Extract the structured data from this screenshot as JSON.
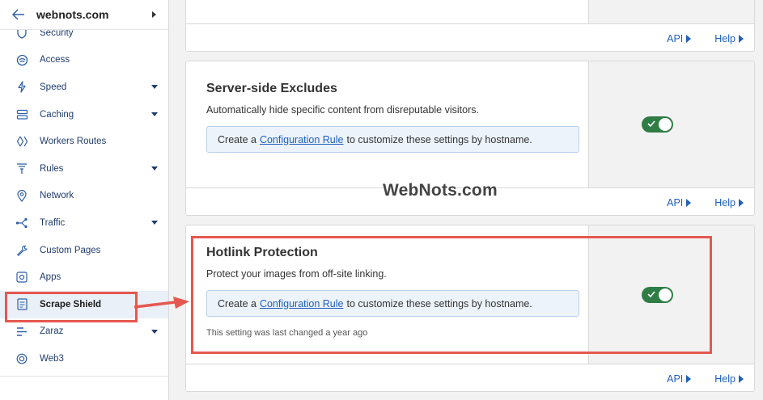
{
  "sidebar": {
    "domain": "webnots.com",
    "items": [
      {
        "label": "Security",
        "icon": "shield-icon",
        "caret": false
      },
      {
        "label": "Access",
        "icon": "access-icon",
        "caret": false
      },
      {
        "label": "Speed",
        "icon": "lightning-icon",
        "caret": true
      },
      {
        "label": "Caching",
        "icon": "caching-icon",
        "caret": true
      },
      {
        "label": "Workers Routes",
        "icon": "workers-icon",
        "caret": false
      },
      {
        "label": "Rules",
        "icon": "rules-icon",
        "caret": true
      },
      {
        "label": "Network",
        "icon": "location-pin-icon",
        "caret": false
      },
      {
        "label": "Traffic",
        "icon": "traffic-icon",
        "caret": true
      },
      {
        "label": "Custom Pages",
        "icon": "wrench-icon",
        "caret": false
      },
      {
        "label": "Apps",
        "icon": "apps-icon",
        "caret": false
      },
      {
        "label": "Scrape Shield",
        "icon": "scrape-shield-icon",
        "caret": false,
        "active": true
      },
      {
        "label": "Zaraz",
        "icon": "zaraz-icon",
        "caret": true
      },
      {
        "label": "Web3",
        "icon": "web3-icon",
        "caret": false
      }
    ]
  },
  "cards": {
    "top": {
      "api": "API",
      "help": "Help"
    },
    "server_side_excludes": {
      "title": "Server-side Excludes",
      "description": "Automatically hide specific content from disreputable visitors.",
      "info_prefix": "Create a",
      "info_link": "Configuration Rule",
      "info_suffix": "to customize these settings by hostname.",
      "enabled": true,
      "api": "API",
      "help": "Help"
    },
    "hotlink_protection": {
      "title": "Hotlink Protection",
      "description": "Protect your images from off-site linking.",
      "info_prefix": "Create a",
      "info_link": "Configuration Rule",
      "info_suffix": "to customize these settings by hostname.",
      "changed_note": "This setting was last changed a year ago",
      "enabled": true,
      "api": "API",
      "help": "Help"
    }
  },
  "watermark": "WebNots.com",
  "colors": {
    "accent": "#1f5fbf",
    "toggle_on": "#2f7d45",
    "annotation": "#e5584f"
  }
}
